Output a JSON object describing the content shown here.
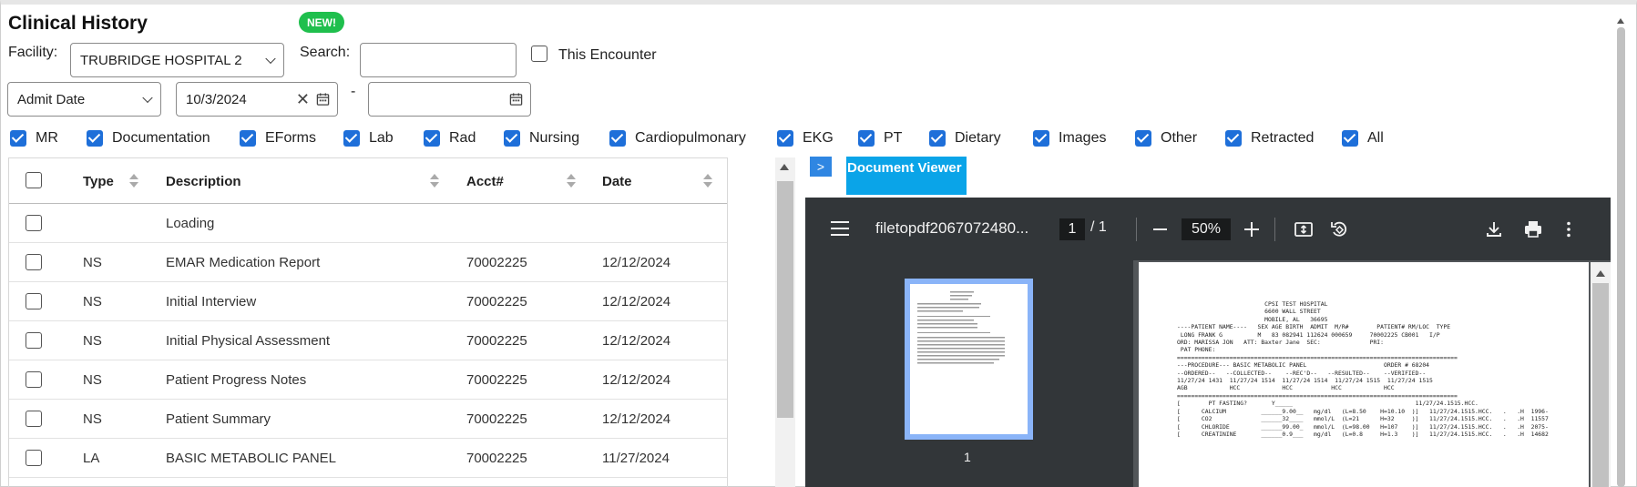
{
  "header": {
    "title": "Clinical History",
    "new_badge": "NEW!"
  },
  "filters": {
    "facility_label": "Facility:",
    "facility_value": "TRUBRIDGE HOSPITAL 2",
    "search_label": "Search:",
    "search_value": "",
    "this_encounter_label": "This Encounter",
    "this_encounter_checked": false,
    "date_type_value": "Admit Date",
    "date_from_value": "10/3/2024",
    "date_separator": "-",
    "date_to_value": ""
  },
  "categories": [
    {
      "label": "MR",
      "checked": true
    },
    {
      "label": "Documentation",
      "checked": true
    },
    {
      "label": "EForms",
      "checked": true
    },
    {
      "label": "Lab",
      "checked": true
    },
    {
      "label": "Rad",
      "checked": true
    },
    {
      "label": "Nursing",
      "checked": true
    },
    {
      "label": "Cardiopulmonary",
      "checked": true
    },
    {
      "label": "EKG",
      "checked": true
    },
    {
      "label": "PT",
      "checked": true
    },
    {
      "label": "Dietary",
      "checked": true
    },
    {
      "label": "Images",
      "checked": true
    },
    {
      "label": "Other",
      "checked": true
    },
    {
      "label": "Retracted",
      "checked": true
    },
    {
      "label": "All",
      "checked": true
    }
  ],
  "table": {
    "columns": {
      "type": "Type",
      "description": "Description",
      "acct": "Acct#",
      "date": "Date"
    },
    "rows": [
      {
        "type": "",
        "description": "Loading",
        "acct": "",
        "date": ""
      },
      {
        "type": "NS",
        "description": "EMAR Medication Report",
        "acct": "70002225",
        "date": "12/12/2024"
      },
      {
        "type": "NS",
        "description": "Initial Interview",
        "acct": "70002225",
        "date": "12/12/2024"
      },
      {
        "type": "NS",
        "description": "Initial Physical Assessment",
        "acct": "70002225",
        "date": "12/12/2024"
      },
      {
        "type": "NS",
        "description": "Patient Progress Notes",
        "acct": "70002225",
        "date": "12/12/2024"
      },
      {
        "type": "NS",
        "description": "Patient Summary",
        "acct": "70002225",
        "date": "12/12/2024"
      },
      {
        "type": "LA",
        "description": "BASIC METABOLIC PANEL",
        "acct": "70002225",
        "date": "11/27/2024"
      }
    ]
  },
  "viewer": {
    "toggle_glyph": ">",
    "title": "Document Viewer",
    "filename": "filetopdf2067072480...",
    "page_current": "1",
    "page_of": "/  1",
    "zoom": "50%",
    "thumb_page_num": "1",
    "document_text": "                         CPSI TEST HOSPITAL\n                         6600 WALL STREET\n                         MOBILE, AL   36695\n----PATIENT NAME----   SEX AGE BIRTH  ADMIT  M/R#        PATIENT# RM/LOC  TYPE\n LONG FRANK G          M   83 082941 112624 000659     70002225 CB001   I/P\nORD: MARISSA JON   ATT: Baxter Jane  SEC:              PRI:\n PAT PHONE:\n================================================================================\n---PROCEDURE--- BASIC METABOLIC PANEL                      ORDER # 68204\n--ORDERED--   --COLLECTED--    --REC'D--   --RESULTED--    --VERIFIED--\n11/27/24 1431  11/27/24 1514  11/27/24 1514  11/27/24 1515  11/27/24 1515\nAGB            HCC            HCC           HCC            HCC\n================================================================================\n[        PT FASTING?       Y_____                                   11/27/24.1515.HCC.\n[      CALCIUM          ______9.00__   mg/dl   (L=8.50    H=10.10  )]   11/27/24.1515.HCC.   .   .H  1996-\n[      CO2              ______32____   mmol/L  (L=21      H=32     )]   11/27/24.1515.HCC.   .   .H  11557\n[      CHLORIDE         ______99.00_   mmol/L  (L=98.00   H=107    )]   11/27/24.1515.HCC.   .   .H  2075-\n[      CREATININE       ______0.9___   mg/dl   (L=0.8     H=1.3    )]   11/27/24.1515.HCC.   .   .H  14682"
  },
  "colors": {
    "accent": "#1e6fd9",
    "badge": "#1fbf4d",
    "viewer_title": "#0aa4e8",
    "viewer_toolbar": "#323639"
  },
  "icons": [
    "calendar-icon",
    "clear-icon",
    "chevron-down-icon",
    "sort-icon",
    "menu-icon",
    "download-icon",
    "print-icon",
    "more-vert-icon",
    "fit-page-icon",
    "rotate-icon"
  ]
}
